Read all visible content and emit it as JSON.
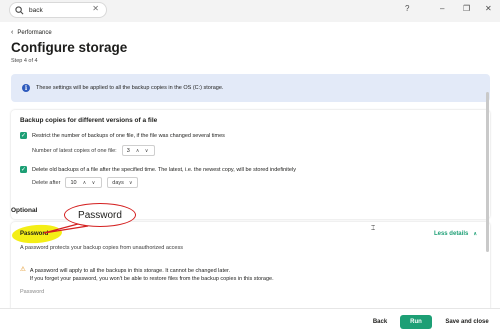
{
  "titlebar": {
    "search_value": "back",
    "help_label": "?",
    "minimize_label": "–",
    "restore_label": "❐",
    "close_label": "✕"
  },
  "page": {
    "breadcrumb": "Performance",
    "title": "Configure storage",
    "step": "Step 4 of 4"
  },
  "info": {
    "text": "These settings will be applied to all the backup copies in the OS (C:) storage."
  },
  "backup_versions": {
    "title": "Backup copies for different versions of a file",
    "restrict_label": "Restrict the number of backups of one file, if the file was changed several times",
    "restrict_checked": true,
    "latest_copies_label": "Number of latest copies of one file:",
    "latest_copies_value": "3",
    "delete_old_label": "Delete old backups of a file after the specified time. The latest, i.e. the newest copy, will be stored indefinitely",
    "delete_old_checked": true,
    "delete_after_label": "Delete after",
    "delete_after_value": "10",
    "delete_after_unit": "days"
  },
  "optional": {
    "heading": "Optional",
    "password_title": "Password",
    "password_desc": "A password protects your backup copies from unauthorized access",
    "less_details": "Less details",
    "warning_line1": "A password will apply to all the backups in this storage. It cannot be changed later.",
    "warning_line2": "If you forget your password, you won't be able to restore files from the backup copies in this storage.",
    "password_field_label": "Password"
  },
  "annotation": {
    "callout_text": "Password"
  },
  "footer": {
    "back_label": "Back",
    "run_label": "Run",
    "save_close_label": "Save and close"
  },
  "colors": {
    "accent": "#1d9f75",
    "info_bg": "#e3eaf8",
    "highlight": "#f4ee16",
    "callout_border": "#d42020",
    "warning": "#e08b12"
  }
}
